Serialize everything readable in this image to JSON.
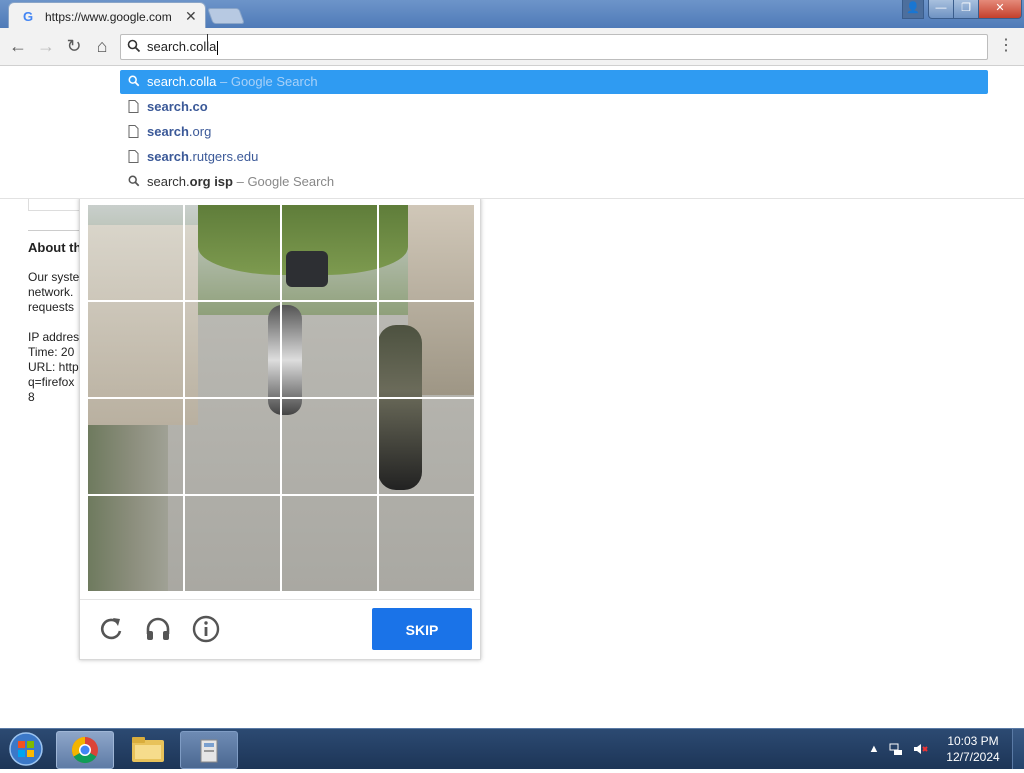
{
  "browser": {
    "tab_title": "https://www.google.com",
    "tab_favicon": "G",
    "tab_close": "✕",
    "window_buttons": {
      "profile": "👤",
      "minimize": "—",
      "maximize": "❐",
      "close": "✕"
    },
    "toolbar": {
      "back": "←",
      "forward": "→",
      "reload": "↻",
      "home": "⌂",
      "menu": "⋮"
    },
    "omnibox": {
      "value": "search.colla"
    }
  },
  "suggestions": [
    {
      "bold": "search.colla",
      "normal": "",
      "suffix": " – Google Search",
      "icon": "search-icon",
      "selected": true
    },
    {
      "bold": "search.co",
      "normal": "",
      "suffix": "",
      "icon": "page-icon",
      "selected": false
    },
    {
      "bold": "search",
      "normal": ".org",
      "suffix": "",
      "icon": "page-icon",
      "selected": false
    },
    {
      "bold": "search",
      "normal": ".rutgers.edu",
      "suffix": "",
      "icon": "page-icon",
      "selected": false
    },
    {
      "bold_pre": "search.",
      "bold": "org isp",
      "normal": "",
      "suffix": " – Google Search",
      "icon": "search-icon",
      "selected": false
    }
  ],
  "page": {
    "about_heading": "About th",
    "lines": [
      "Our syste",
      "network.",
      "requests",
      "",
      "IP addres",
      "Time: 20",
      "URL: http",
      "q=firefox",
      "8"
    ]
  },
  "captcha": {
    "skip_label": "SKIP",
    "icons": [
      "reload-icon",
      "headphones-icon",
      "info-icon"
    ]
  },
  "taskbar": {
    "clock_time": "10:03 PM",
    "clock_date": "12/7/2024",
    "apps": [
      "chrome-icon",
      "file-explorer-icon",
      "app-icon"
    ]
  },
  "colors": {
    "accent": "#1a73e8",
    "suggest_selected": "#2f9bf2",
    "taskbar": "#1d3557"
  }
}
